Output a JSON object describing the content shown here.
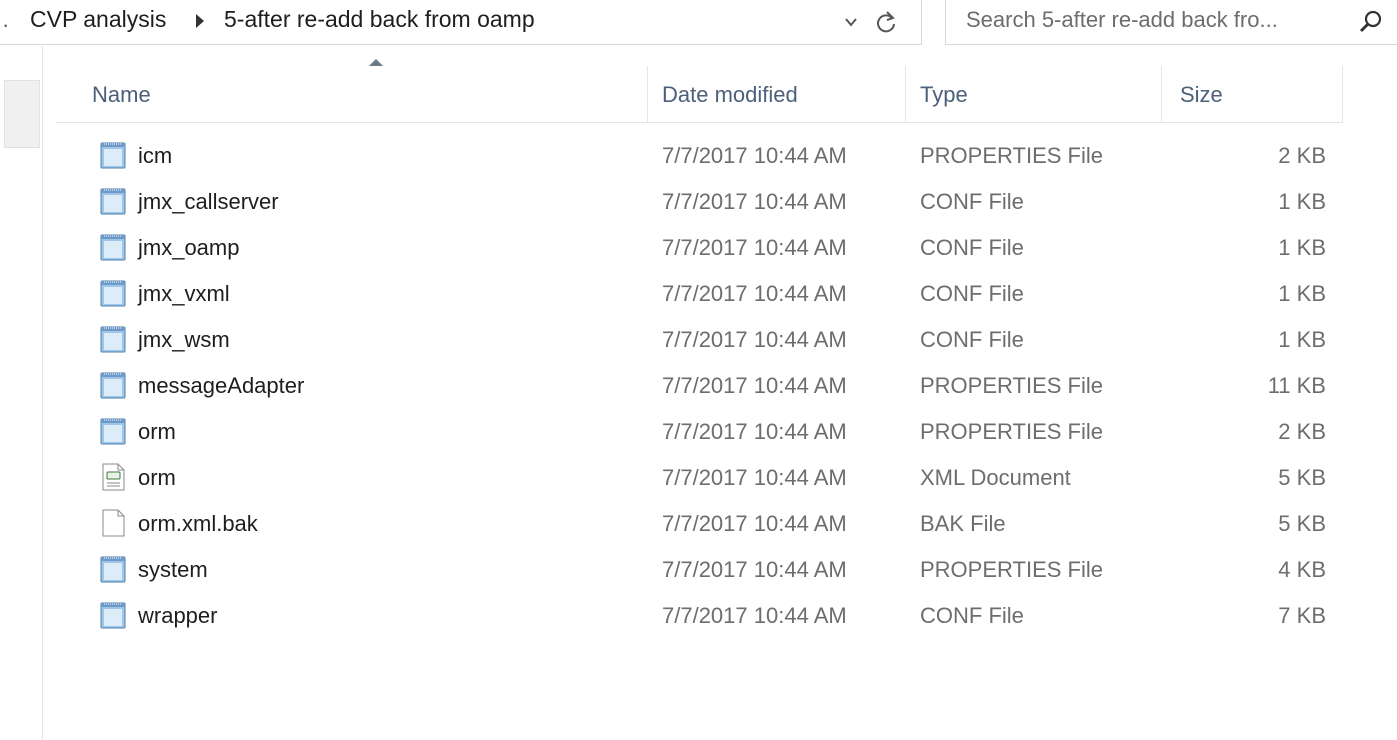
{
  "address": {
    "lead": "·",
    "crumbs": [
      "CVP analysis",
      "5-after re-add back from oamp"
    ]
  },
  "search": {
    "placeholder": "Search 5-after re-add back fro..."
  },
  "columns": {
    "name": "Name",
    "date": "Date modified",
    "type": "Type",
    "size": "Size"
  },
  "files": [
    {
      "name": "icm",
      "date": "7/7/2017 10:44 AM",
      "type": "PROPERTIES File",
      "size": "2 KB",
      "icon": "text-file-icon"
    },
    {
      "name": "jmx_callserver",
      "date": "7/7/2017 10:44 AM",
      "type": "CONF File",
      "size": "1 KB",
      "icon": "text-file-icon"
    },
    {
      "name": "jmx_oamp",
      "date": "7/7/2017 10:44 AM",
      "type": "CONF File",
      "size": "1 KB",
      "icon": "text-file-icon"
    },
    {
      "name": "jmx_vxml",
      "date": "7/7/2017 10:44 AM",
      "type": "CONF File",
      "size": "1 KB",
      "icon": "text-file-icon"
    },
    {
      "name": "jmx_wsm",
      "date": "7/7/2017 10:44 AM",
      "type": "CONF File",
      "size": "1 KB",
      "icon": "text-file-icon"
    },
    {
      "name": "messageAdapter",
      "date": "7/7/2017 10:44 AM",
      "type": "PROPERTIES File",
      "size": "11 KB",
      "icon": "text-file-icon"
    },
    {
      "name": "orm",
      "date": "7/7/2017 10:44 AM",
      "type": "PROPERTIES File",
      "size": "2 KB",
      "icon": "text-file-icon"
    },
    {
      "name": "orm",
      "date": "7/7/2017 10:44 AM",
      "type": "XML Document",
      "size": "5 KB",
      "icon": "xml-file-icon"
    },
    {
      "name": "orm.xml.bak",
      "date": "7/7/2017 10:44 AM",
      "type": "BAK File",
      "size": "5 KB",
      "icon": "blank-file-icon"
    },
    {
      "name": "system",
      "date": "7/7/2017 10:44 AM",
      "type": "PROPERTIES File",
      "size": "4 KB",
      "icon": "text-file-icon"
    },
    {
      "name": "wrapper",
      "date": "7/7/2017 10:44 AM",
      "type": "CONF File",
      "size": "7 KB",
      "icon": "text-file-icon"
    }
  ]
}
